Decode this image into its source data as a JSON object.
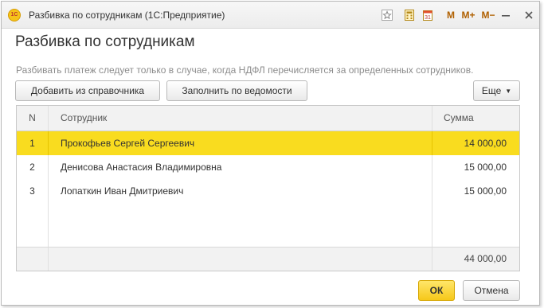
{
  "window": {
    "title": "Разбивка по сотрудникам  (1С:Предприятие)",
    "logo_text": "1С",
    "titlebar_buttons": {
      "favorite_icon": "star-icon",
      "calculator_icon": "calculator-icon",
      "calendar_icon": "calendar-icon",
      "m": "M",
      "m_plus": "M+",
      "m_minus": "M−",
      "minimize": "—",
      "close": "×"
    }
  },
  "form": {
    "title": "Разбивка по сотрудникам",
    "hint": "Разбивать платеж следует только в случае, когда НДФЛ перечисляется за определенных сотрудников."
  },
  "toolbar": {
    "add_from_catalog": "Добавить из справочника",
    "fill_from_statement": "Заполнить по ведомости",
    "more": "Еще"
  },
  "table": {
    "columns": {
      "n": "N",
      "employee": "Сотрудник",
      "sum": "Сумма"
    },
    "rows": [
      {
        "n": "1",
        "employee": "Прокофьев Сергей Сергеевич",
        "sum": "14 000,00"
      },
      {
        "n": "2",
        "employee": "Денисова Анастасия Владимировна",
        "sum": "15 000,00"
      },
      {
        "n": "3",
        "employee": "Лопаткин Иван Дмитриевич",
        "sum": "15 000,00"
      }
    ],
    "total": "44 000,00"
  },
  "footer": {
    "ok": "ОК",
    "cancel": "Отмена"
  },
  "colors": {
    "selection": "#f9dc1f",
    "ok_button": "#f6c81a"
  }
}
